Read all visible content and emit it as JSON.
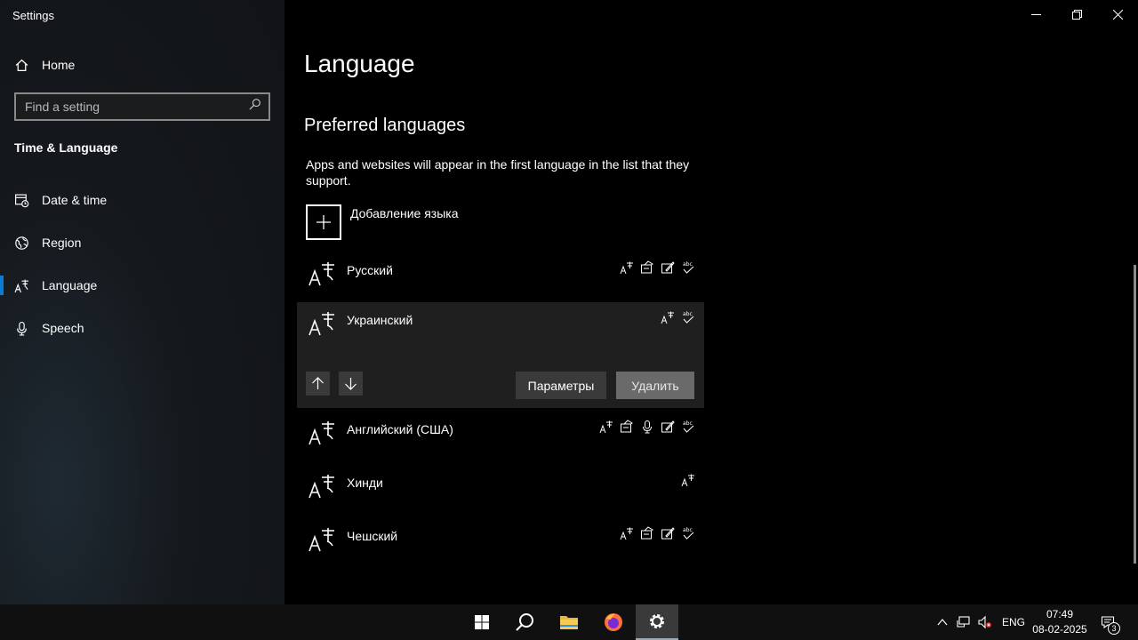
{
  "window": {
    "title": "Settings"
  },
  "sidebar": {
    "home_label": "Home",
    "search_placeholder": "Find a setting",
    "section_heading": "Time & Language",
    "items": [
      {
        "label": "Date & time",
        "icon": "calendar-clock-icon"
      },
      {
        "label": "Region",
        "icon": "globe-icon"
      },
      {
        "label": "Language",
        "icon": "language-icon",
        "selected": true
      },
      {
        "label": "Speech",
        "icon": "microphone-icon"
      }
    ]
  },
  "main": {
    "page_title": "Language",
    "section_title": "Preferred languages",
    "description": "Apps and websites will appear in the first language in the list that they support.",
    "add_language_label": "Добавление языка",
    "languages": [
      {
        "name": "Русский",
        "features": [
          "display-language",
          "text-to-speech",
          "handwriting",
          "spell-check"
        ]
      },
      {
        "name": "Украинский",
        "features": [
          "display-language",
          "spell-check"
        ],
        "expanded": true
      },
      {
        "name": "Английский (США)",
        "features": [
          "display-language",
          "text-to-speech",
          "speech-recognition",
          "handwriting",
          "spell-check"
        ]
      },
      {
        "name": "Хинди",
        "features": [
          "display-language"
        ]
      },
      {
        "name": "Чешский",
        "features": [
          "display-language",
          "text-to-speech",
          "handwriting",
          "spell-check"
        ]
      }
    ],
    "options_button_label": "Параметры",
    "remove_button_label": "Удалить"
  },
  "taskbar": {
    "apps": [
      "windows-start-icon",
      "search-icon",
      "file-explorer-icon",
      "firefox-icon",
      "settings-gear-icon"
    ],
    "input_language": "ENG",
    "time": "07:49",
    "date": "08-02-2025",
    "notification_count": "3"
  },
  "colors": {
    "accent": "#0a7cd8",
    "sidebar_bg": "#15191d",
    "content_bg": "#000000",
    "expanded_row_bg": "#1f1f1f"
  }
}
